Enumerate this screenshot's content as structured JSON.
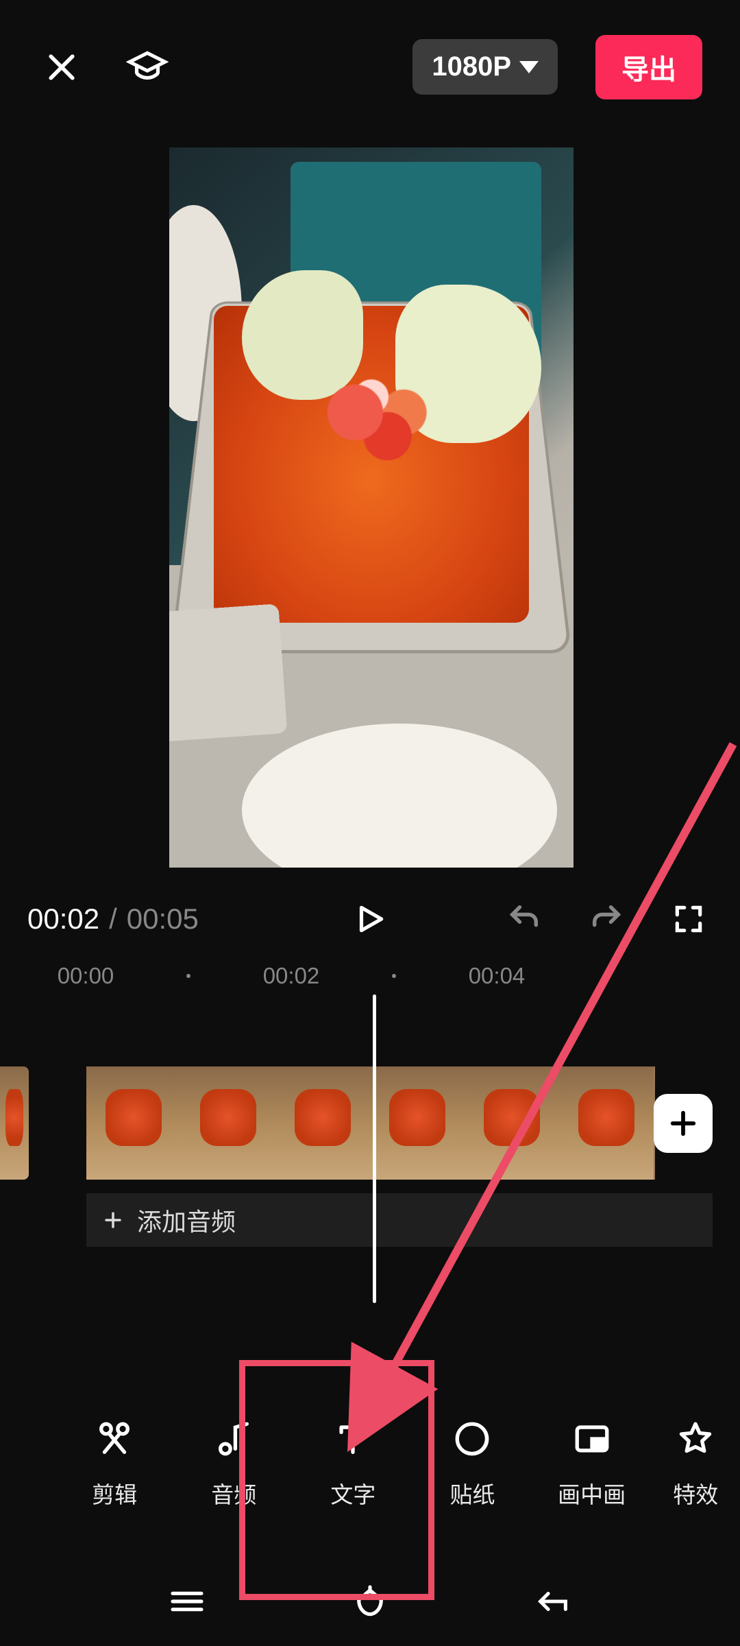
{
  "top": {
    "resolution": "1080P",
    "export": "导出"
  },
  "time": {
    "current": "00:02",
    "sep": "/",
    "total": "00:05"
  },
  "ruler": {
    "t0": "00:00",
    "t1": "00:02",
    "t2": "00:04"
  },
  "audio": {
    "add_label": "添加音频"
  },
  "tools": {
    "edit": "剪辑",
    "audio": "音频",
    "text": "文字",
    "sticker": "贴纸",
    "pip": "画中画",
    "effect": "特效"
  }
}
